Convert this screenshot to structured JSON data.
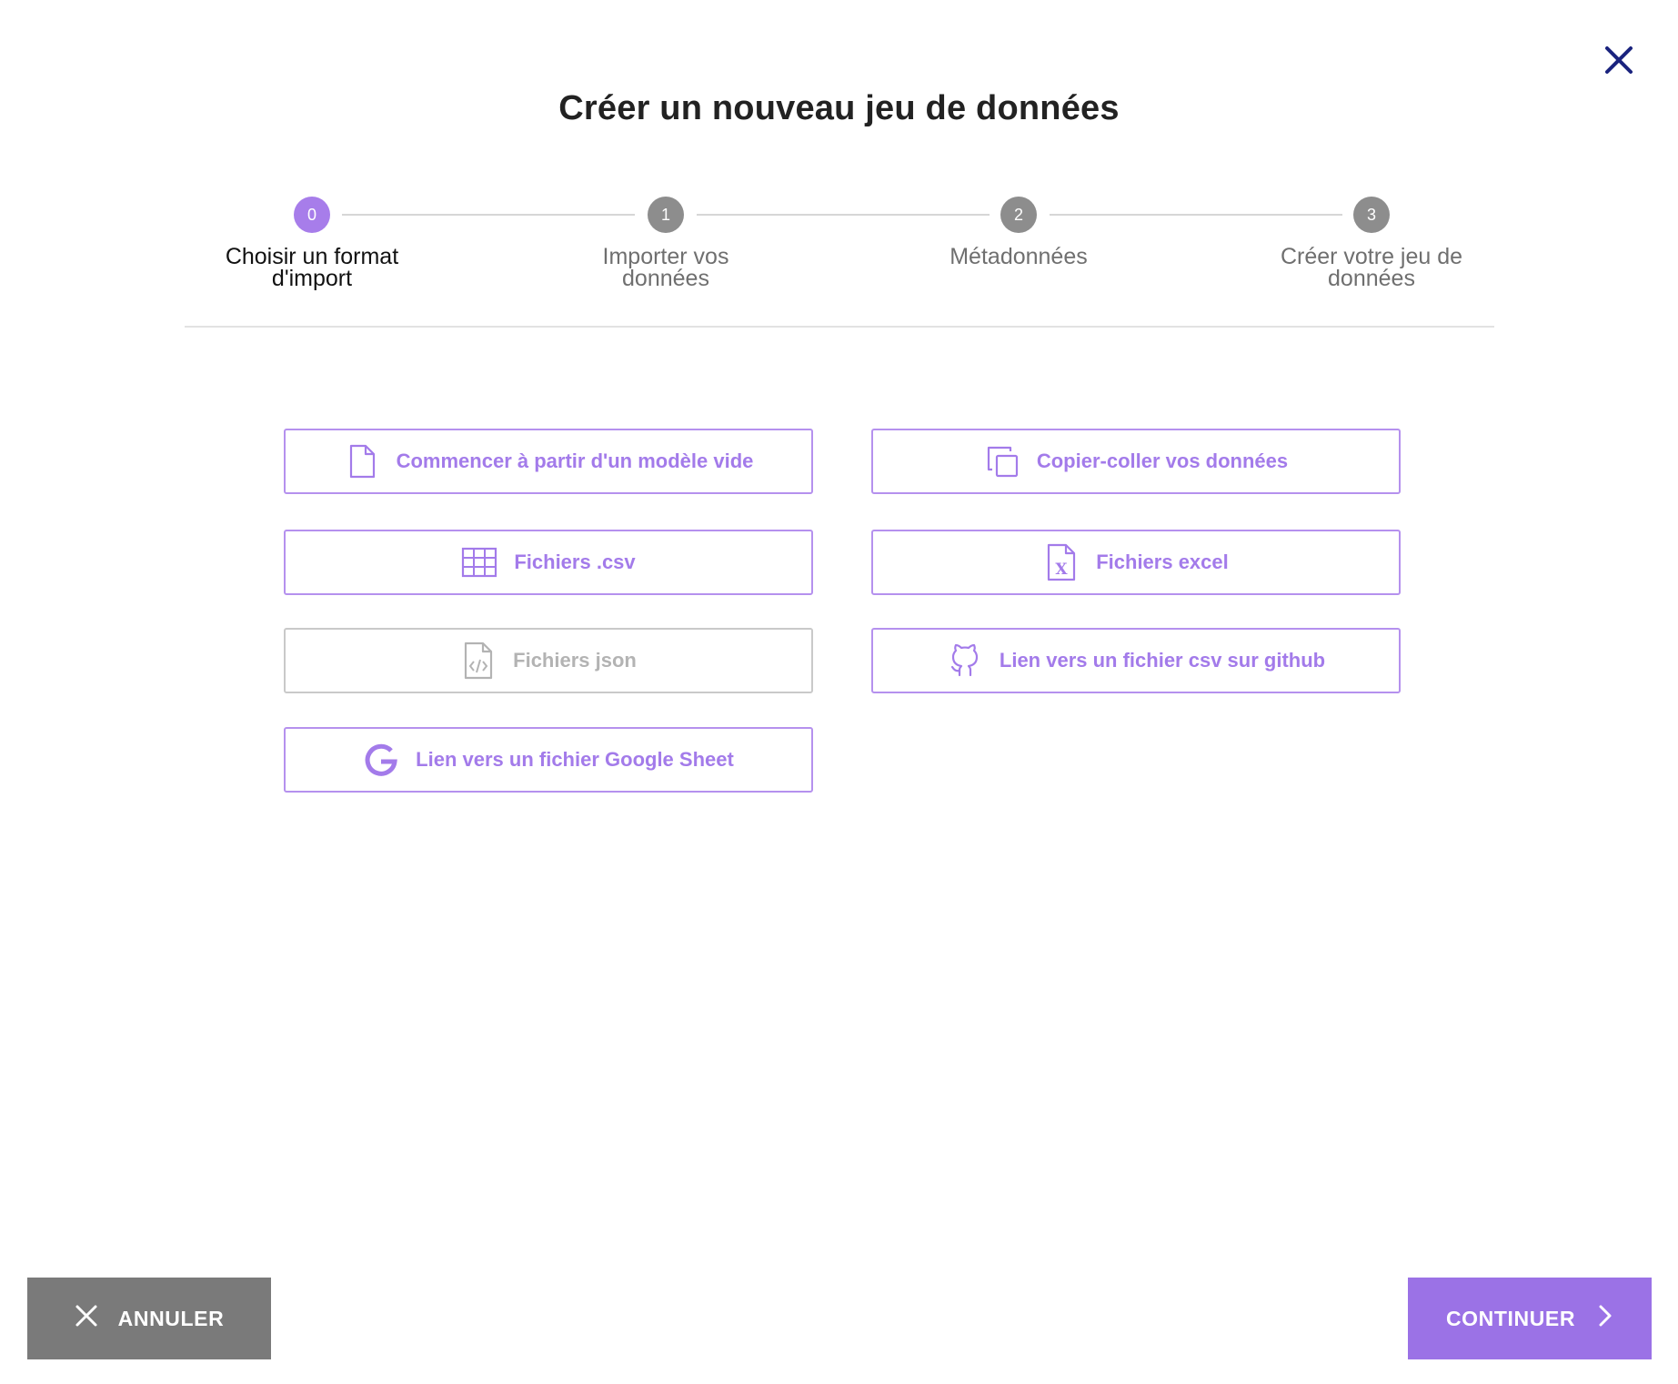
{
  "dialog": {
    "title": "Créer un nouveau jeu de données",
    "close_icon": "close-icon"
  },
  "stepper": {
    "active_step": 0,
    "steps": [
      {
        "number": "0",
        "label": "Choisir un format d'import"
      },
      {
        "number": "1",
        "label": "Importer vos données"
      },
      {
        "number": "2",
        "label": "Métadonnées"
      },
      {
        "number": "3",
        "label": "Créer votre jeu de données"
      }
    ]
  },
  "options": [
    {
      "label": "Commencer à partir d'un modèle vide",
      "icon": "file-icon",
      "enabled": true
    },
    {
      "label": "Copier-coller vos données",
      "icon": "copy-icon",
      "enabled": true
    },
    {
      "label": "Fichiers .csv",
      "icon": "table-icon",
      "enabled": true
    },
    {
      "label": "Fichiers excel",
      "icon": "excel-file-icon",
      "enabled": true
    },
    {
      "label": "Fichiers json",
      "icon": "code-file-icon",
      "enabled": false
    },
    {
      "label": "Lien vers un fichier csv sur github",
      "icon": "github-icon",
      "enabled": true
    },
    {
      "label": "Lien vers un fichier Google Sheet",
      "icon": "google-icon",
      "enabled": true
    }
  ],
  "footer": {
    "cancel_label": "ANNULER",
    "cancel_icon": "close-icon",
    "continue_label": "CONTINUER",
    "continue_icon": "chevron-right-icon"
  },
  "colors": {
    "accent": "#9b72e6",
    "accent_light": "#b591ee",
    "inactive_step": "#8d8d8d",
    "cancel_bg": "#7a7a7a",
    "close_icon": "#1a237e"
  }
}
